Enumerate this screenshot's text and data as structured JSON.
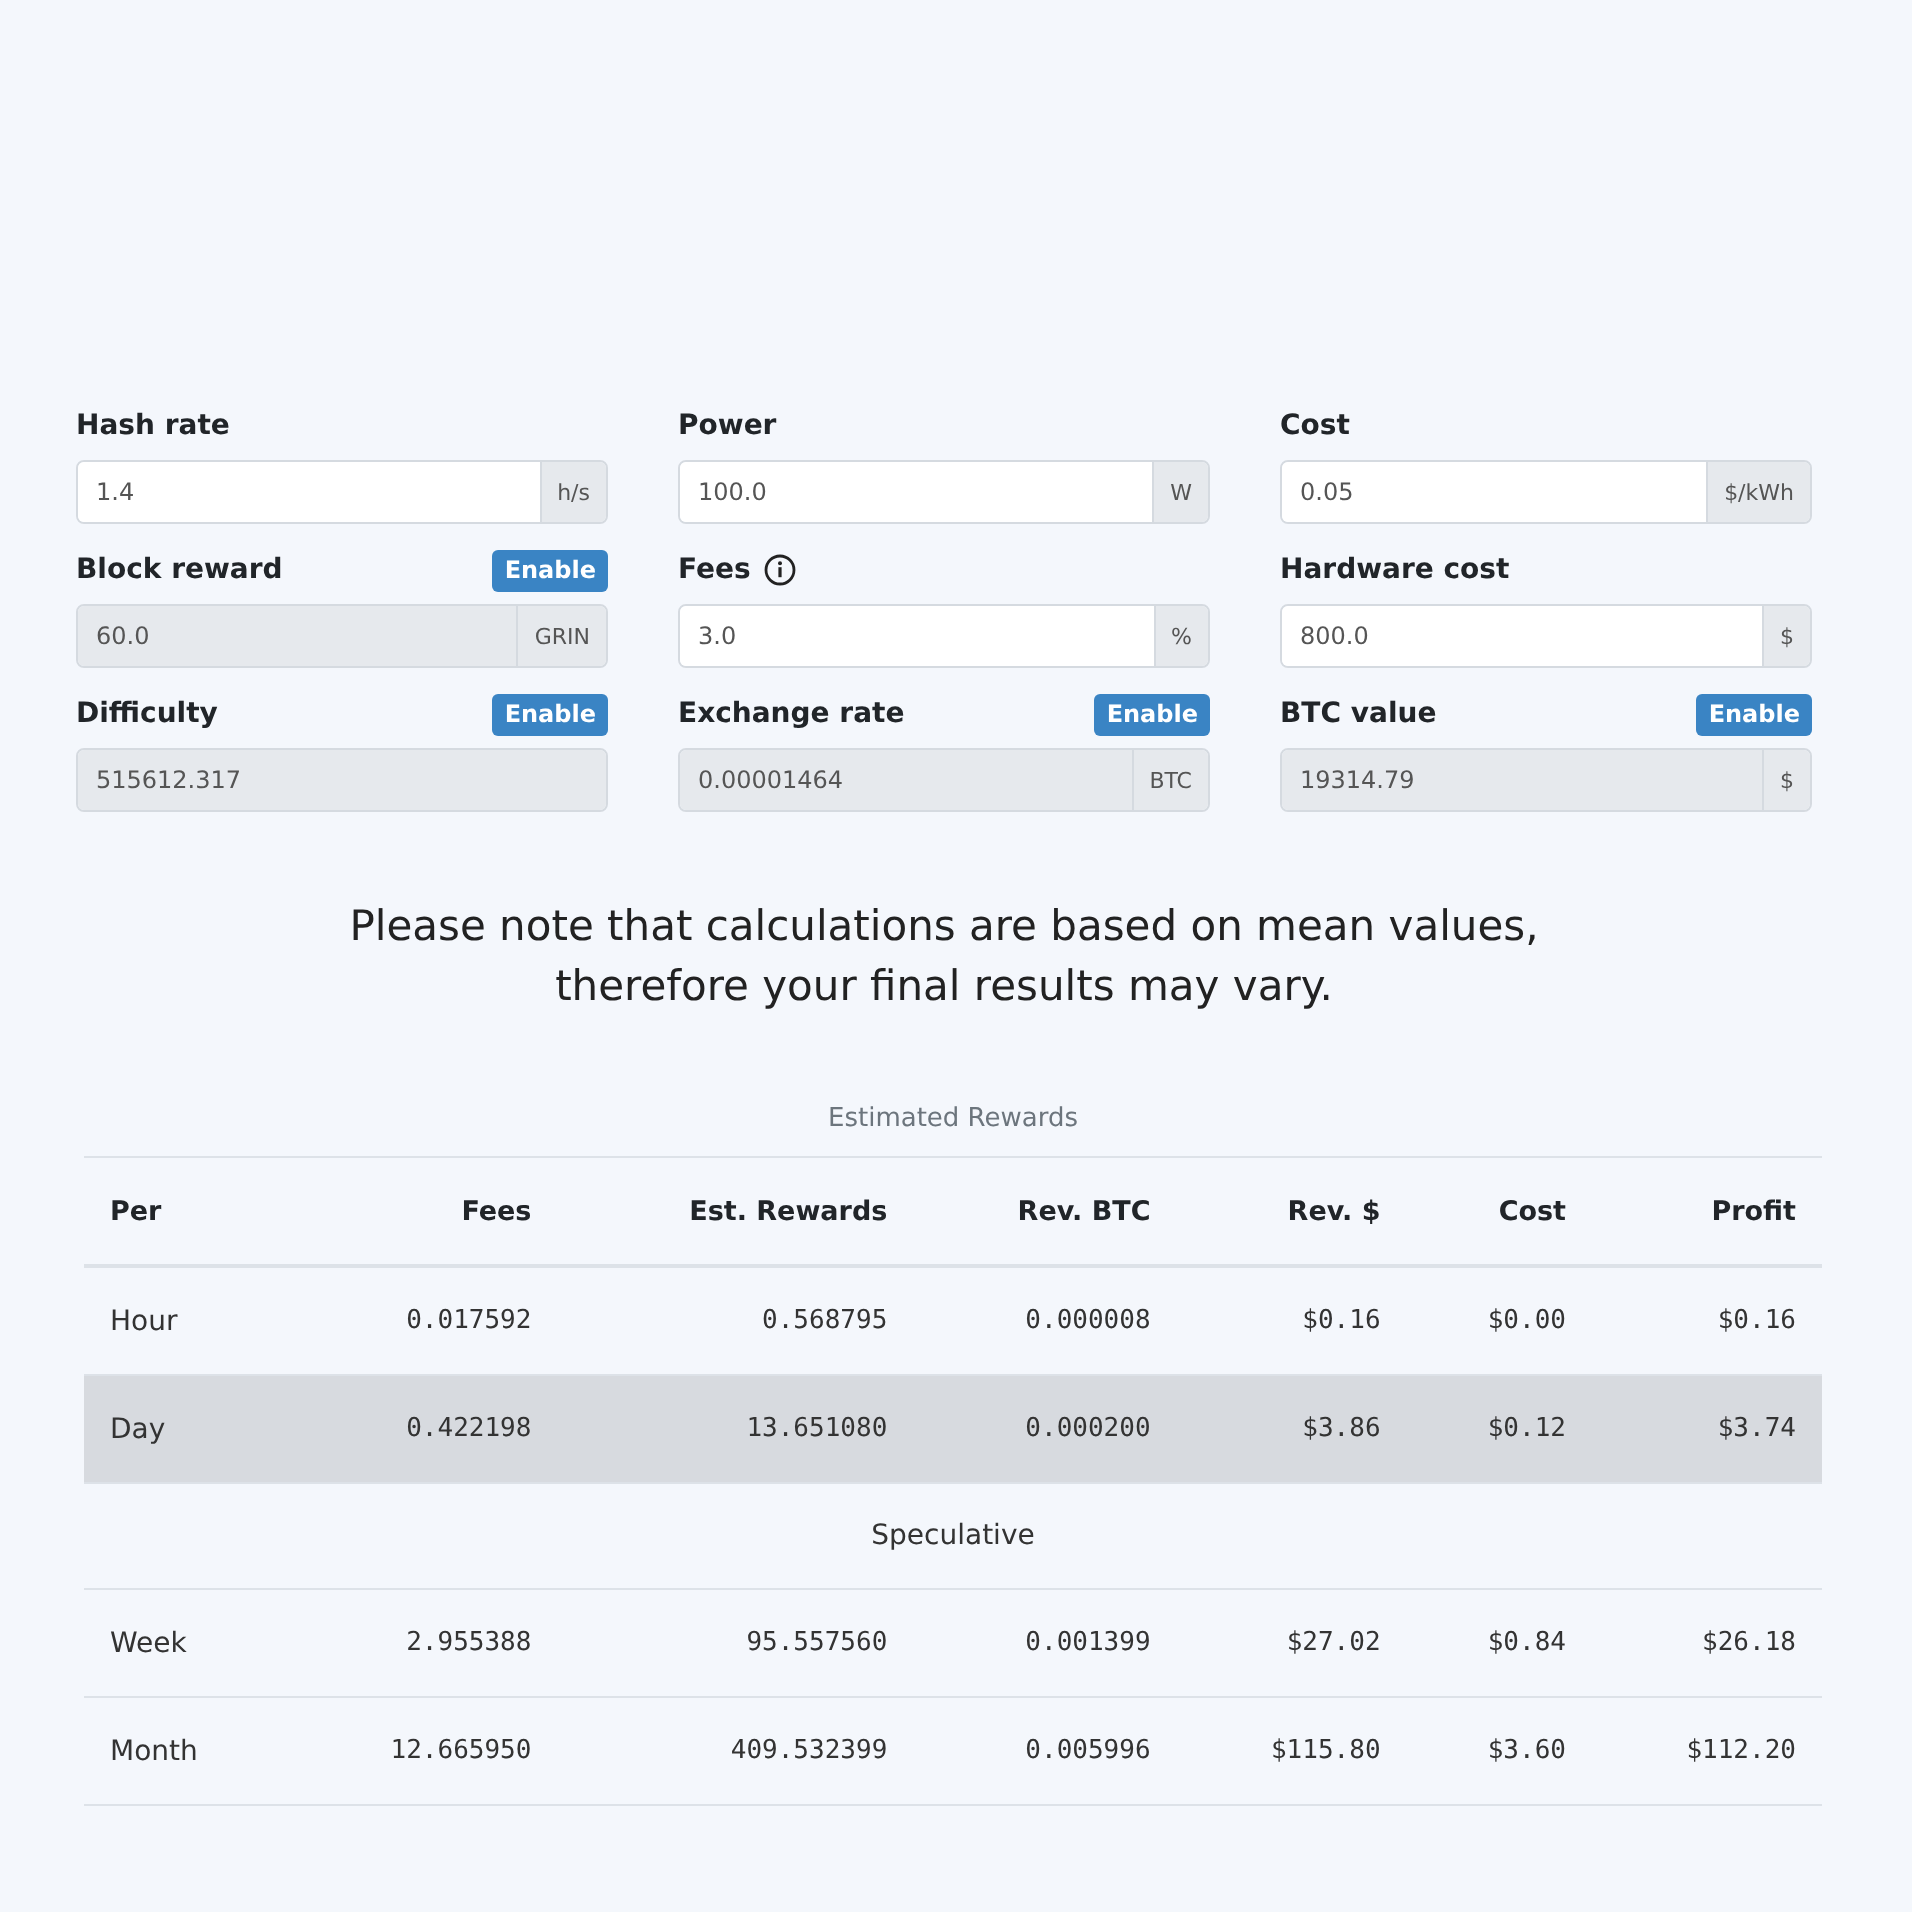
{
  "fields": [
    {
      "label": "Hash rate",
      "value": "1.4",
      "unit": "h/s",
      "disabled": false
    },
    {
      "label": "Power",
      "value": "100.0",
      "unit": "W",
      "disabled": false
    },
    {
      "label": "Cost",
      "value": "0.05",
      "unit": "$/kWh",
      "disabled": false
    },
    {
      "label": "Block reward",
      "value": "60.0",
      "unit": "GRIN",
      "disabled": true,
      "button": "Enable"
    },
    {
      "label": "Fees",
      "value": "3.0",
      "unit": "%",
      "disabled": false,
      "info": true
    },
    {
      "label": "Hardware cost",
      "value": "800.0",
      "unit": "$",
      "disabled": false
    },
    {
      "label": "Difficulty",
      "value": "515612.317",
      "disabled": true,
      "button": "Enable"
    },
    {
      "label": "Exchange rate",
      "value": "0.00001464",
      "unit": "BTC",
      "disabled": true,
      "button": "Enable"
    },
    {
      "label": "BTC value",
      "value": "19314.79",
      "unit": "$",
      "disabled": true,
      "button": "Enable"
    }
  ],
  "note": "Please note that calculations are based on mean values, therefore your final results may vary.",
  "table": {
    "caption": "Estimated Rewards",
    "columns": [
      "Per",
      "Fees",
      "Est. Rewards",
      "Rev. BTC",
      "Rev. $",
      "Cost",
      "Profit"
    ],
    "rows": [
      {
        "kind": "data",
        "highlighted": false,
        "cells": [
          "Hour",
          "0.017592",
          "0.568795",
          "0.000008",
          "$0.16",
          "$0.00",
          "$0.16"
        ]
      },
      {
        "kind": "data",
        "highlighted": true,
        "cells": [
          "Day",
          "0.422198",
          "13.651080",
          "0.000200",
          "$3.86",
          "$0.12",
          "$3.74"
        ]
      },
      {
        "kind": "section",
        "label": "Speculative"
      },
      {
        "kind": "data",
        "highlighted": false,
        "cells": [
          "Week",
          "2.955388",
          "95.557560",
          "0.001399",
          "$27.02",
          "$0.84",
          "$26.18"
        ]
      },
      {
        "kind": "data",
        "highlighted": false,
        "cells": [
          "Month",
          "12.665950",
          "409.532399",
          "0.005996",
          "$115.80",
          "$3.60",
          "$112.20"
        ]
      }
    ]
  }
}
